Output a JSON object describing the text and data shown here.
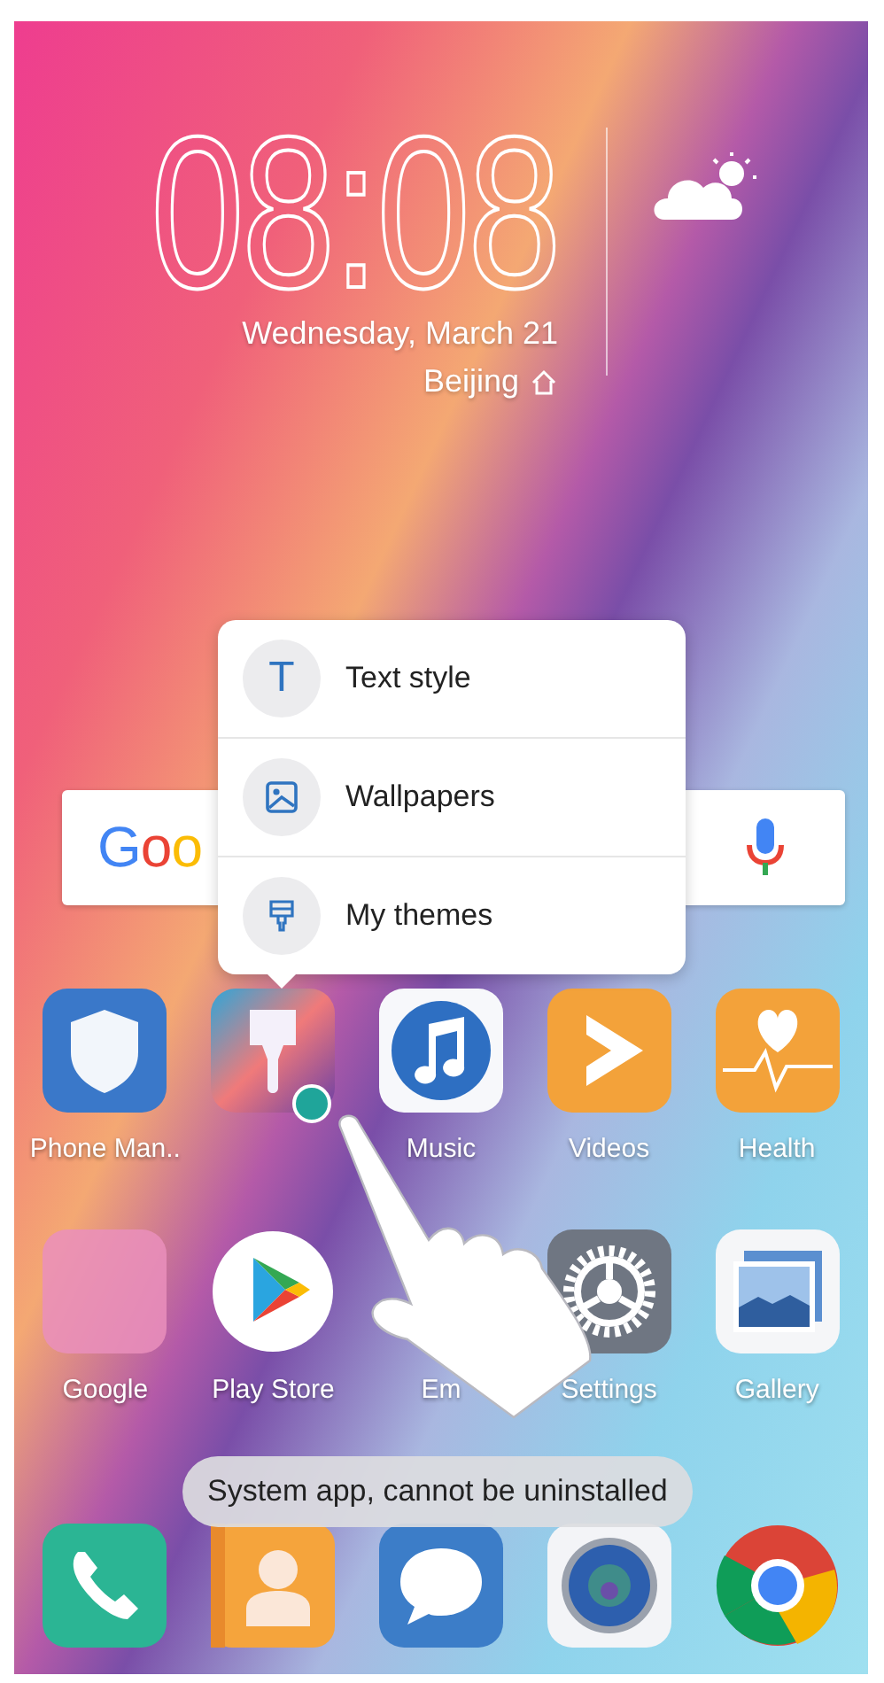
{
  "clock": {
    "time": "08:08",
    "date": "Wednesday, March 21",
    "location": "Beijing"
  },
  "search_bar": {
    "logo": "Goo"
  },
  "popup_menu": {
    "items": [
      {
        "kind": "text",
        "label": "Text style",
        "icon_text": "T"
      },
      {
        "kind": "wallpaper",
        "label": "Wallpapers"
      },
      {
        "kind": "theme",
        "label": "My themes"
      }
    ]
  },
  "apps": [
    {
      "kind": "shield",
      "label": "Phone Man..",
      "pressed": false
    },
    {
      "kind": "brush",
      "pressed": true
    },
    {
      "kind": "music",
      "label": "Music",
      "pressed": false
    },
    {
      "kind": "videos",
      "label": "Videos",
      "pressed": false
    },
    {
      "kind": "health",
      "label": "Health",
      "pressed": false
    },
    {
      "kind": "folder",
      "label": "Google",
      "pressed": false
    },
    {
      "kind": "play",
      "label": "Play Store",
      "pressed": false
    },
    {
      "kind": "hidden",
      "label": "Em",
      "pressed": false
    },
    {
      "kind": "settings",
      "label": "Settings",
      "pressed": false
    },
    {
      "kind": "gallery",
      "label": "Gallery",
      "pressed": false
    }
  ],
  "toast": "System app, cannot be uninstalled",
  "dock": [
    {
      "kind": "phone"
    },
    {
      "kind": "contacts"
    },
    {
      "kind": "messages"
    },
    {
      "kind": "camera"
    },
    {
      "kind": "chrome"
    }
  ]
}
